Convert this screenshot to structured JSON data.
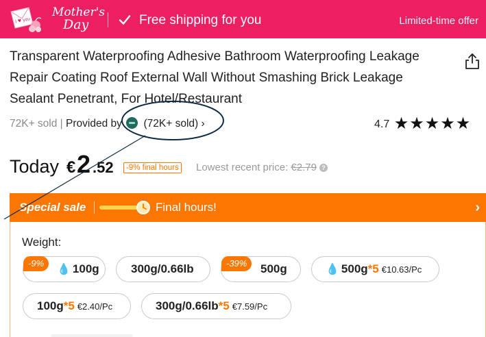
{
  "banner": {
    "logo_text": "I ♥ you mom",
    "script_line1": "Mother's",
    "script_line2": "Day",
    "shipping_text": "Free shipping for you",
    "limited_text": "Limited-time offer",
    "icon": "check-icon"
  },
  "product": {
    "title": "Transparent Waterproofing Adhesive Bathroom Waterproofing Leakage Repair Coating Roof External Wall Without Smashing Brick Leakage Sealant Penetrant, For Hotel/Restaurant",
    "share_icon": "share-icon",
    "sold_count": "72K+ sold",
    "sep": " | ",
    "provided_by": "Provided by",
    "store_sold": "(72K+ sold)",
    "chevron": "›",
    "rating_value": "4.7",
    "stars": "★★★★★",
    "rating": 4.7
  },
  "price": {
    "today_label": "Today",
    "currency": "€",
    "integer": "2",
    "decimal": ".52",
    "badge": "-9% final hours",
    "lowest_label": "Lowest recent price:",
    "lowest_value": "€2.79",
    "help": "?"
  },
  "sale": {
    "label": "Special sale",
    "final_text": "Final hours!",
    "arrow": "›",
    "progress": 0.7,
    "colors": {
      "accent": "#fb7701",
      "progress": "#ffd24d"
    }
  },
  "weight": {
    "label": "Weight:",
    "options": [
      {
        "tag": "-9%",
        "drop": "💧",
        "main": "100g",
        "mult": "",
        "price": ""
      },
      {
        "tag": "",
        "drop": "",
        "main": "300g/0.66lb",
        "mult": "",
        "price": ""
      },
      {
        "tag": "-39%",
        "drop": "",
        "main": "500g",
        "mult": "",
        "price": ""
      },
      {
        "tag": "",
        "drop": "💧",
        "main": "500g",
        "mult": "*5",
        "price": "€10.63/Pc"
      },
      {
        "tag": "",
        "drop": "",
        "main": "100g",
        "mult": "*5",
        "price": "€2.40/Pc"
      },
      {
        "tag": "",
        "drop": "",
        "main": "300g/0.66lb",
        "mult": "*5",
        "price": "€7.59/Pc"
      }
    ]
  },
  "colors": {
    "banner": "#ec1f63",
    "accent": "#fb7701",
    "annotation": "#0d2a44"
  }
}
